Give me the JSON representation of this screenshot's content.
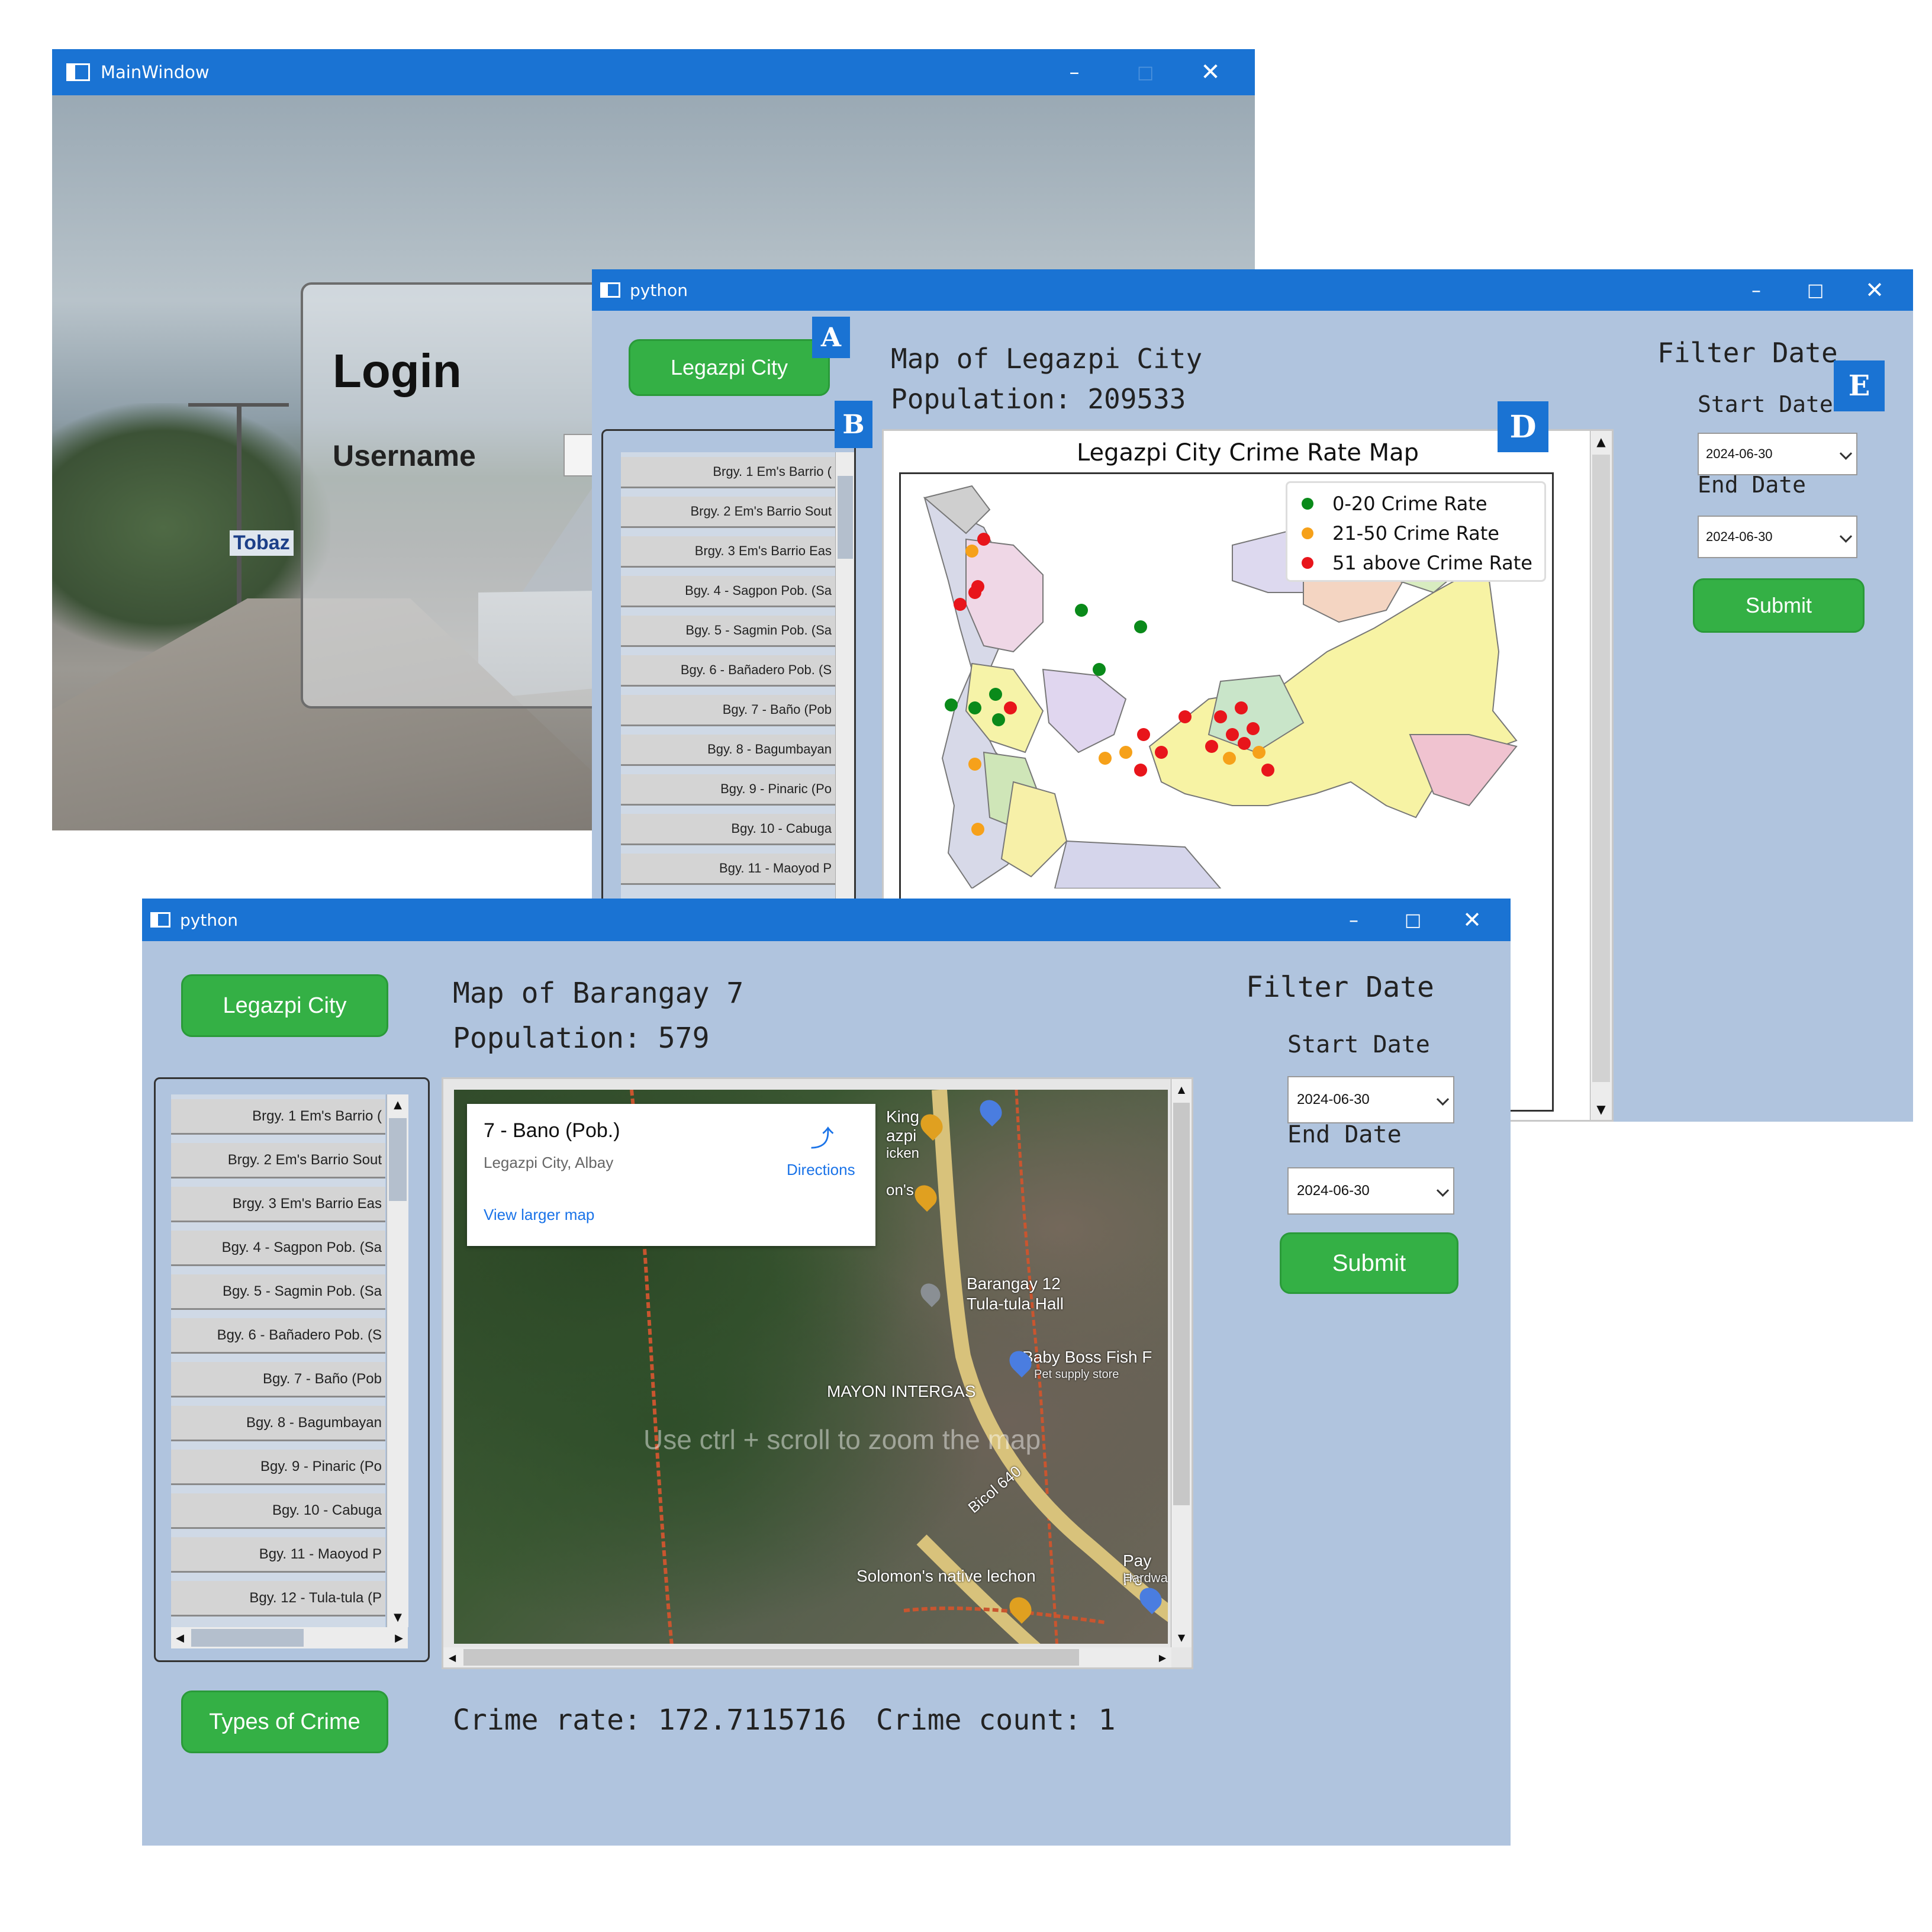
{
  "login_window": {
    "title": "MainWindow",
    "login_title": "Login",
    "username_label": "Username",
    "bg_banner": "Tobaz"
  },
  "city_window": {
    "title": "python",
    "city_button": "Legazpi City",
    "map_title_line": "Map of Legazpi City",
    "population_line": "Population: 209533",
    "filter_title": "Filter Date",
    "start_label": "Start Date",
    "start_value": "2024-06-30",
    "end_label": "End Date",
    "end_value": "2024-06-30",
    "submit": "Submit",
    "badges": [
      "A",
      "B",
      "D",
      "E"
    ],
    "barangays": [
      "Brgy. 1 Em's Barrio (",
      "Brgy. 2 Em's Barrio Sout",
      "Brgy. 3 Em's Barrio Eas",
      "Bgy. 4 - Sagpon Pob. (Sa",
      "Bgy. 5 - Sagmin Pob. (Sa",
      "Bgy. 6 - Bañadero Pob. (S",
      "Bgy. 7 - Baño (Pob",
      "Bgy. 8 - Bagumbayan",
      "Bgy. 9 - Pinaric (Po",
      "Bgy. 10 - Cabuga",
      "Bgy. 11 - Maoyod P"
    ],
    "map": {
      "title": "Legazpi City Crime Rate Map",
      "legend": [
        {
          "label": "0-20 Crime Rate",
          "color": "#0a8a1a"
        },
        {
          "label": "21-50 Crime Rate",
          "color": "#f6a11a"
        },
        {
          "label": "51 above Crime Rate",
          "color": "#e8151b"
        }
      ]
    }
  },
  "barangay_window": {
    "title": "python",
    "city_button": "Legazpi City",
    "map_title_line": "Map of Barangay 7",
    "population_line": "Population: 579",
    "filter_title": "Filter Date",
    "start_label": "Start Date",
    "start_value": "2024-06-30",
    "end_label": "End Date",
    "end_value": "2024-06-30",
    "submit": "Submit",
    "types_button": "Types of Crime",
    "crime_rate_line": "Crime rate: 172.7115716",
    "crime_count_line": "Crime count: 1",
    "barangays": [
      "Brgy. 1 Em's Barrio (",
      "Brgy. 2 Em's Barrio Sout",
      "Brgy. 3 Em's Barrio Eas",
      "Bgy. 4 - Sagpon Pob. (Sa",
      "Bgy. 5 - Sagmin Pob. (Sa",
      "Bgy. 6 - Bañadero Pob. (S",
      "Bgy. 7 - Baño (Pob",
      "Bgy. 8 - Bagumbayan",
      "Bgy. 9 - Pinaric (Po",
      "Bgy. 10 - Cabuga",
      "Bgy. 11 - Maoyod P",
      "Bgy. 12 - Tula-tula (P"
    ],
    "map": {
      "place_name": "7 - Bano (Pob.)",
      "place_sub": "Legazpi City, Albay",
      "directions": "Directions",
      "larger_map": "View larger map",
      "overlay_hint": "Use ctrl + scroll to zoom the map",
      "labels": [
        "Barangay 12",
        "Tula-tula Hall",
        "Baby Boss Fish F",
        "Pet supply store",
        "MAYON INTERGAS",
        "Bicol 640",
        "Solomon's native lechon",
        "Pay Pc",
        "Hardwa",
        "King",
        "azpi",
        "icken",
        "on's"
      ]
    }
  }
}
